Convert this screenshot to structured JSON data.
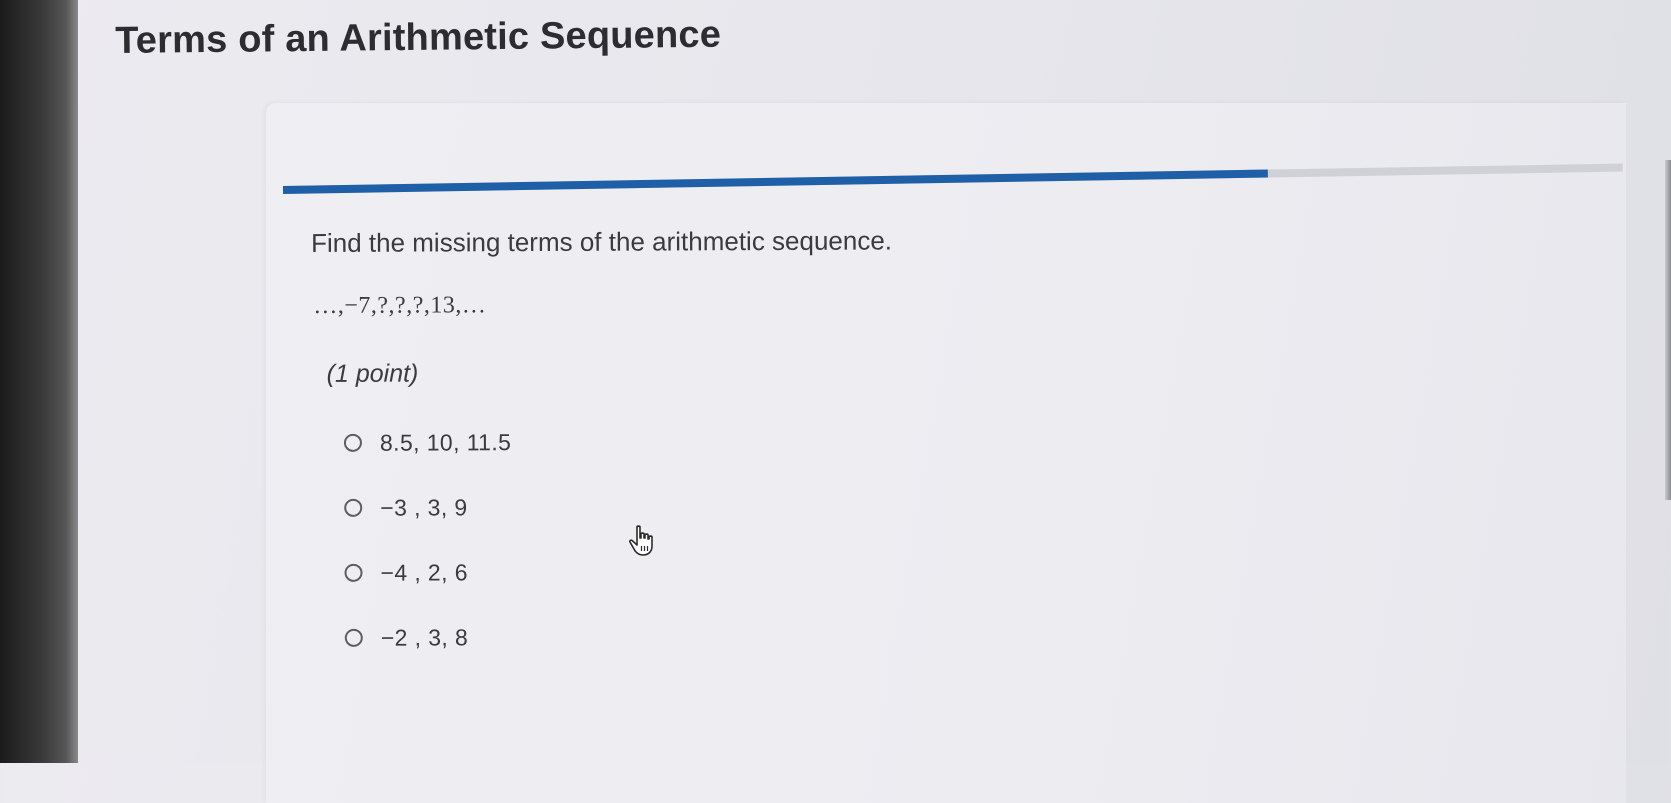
{
  "page": {
    "title": "Terms of an Arithmetic Sequence"
  },
  "progress": {
    "fraction": 0.735,
    "fill_color": "#1f5fa8",
    "track_color": "#cfd1d6"
  },
  "question": {
    "prompt": "Find the missing terms of the arithmetic sequence.",
    "sequence": "…,−7,?,?,?,13,…",
    "points": "(1 point)",
    "options": [
      {
        "label": "8.5, 10, 11.5"
      },
      {
        "label": "−3 , 3, 9"
      },
      {
        "label": "−4 , 2, 6"
      },
      {
        "label": "−2 , 3, 8"
      }
    ]
  },
  "cursor": {
    "icon": "hand-pointer-icon"
  }
}
